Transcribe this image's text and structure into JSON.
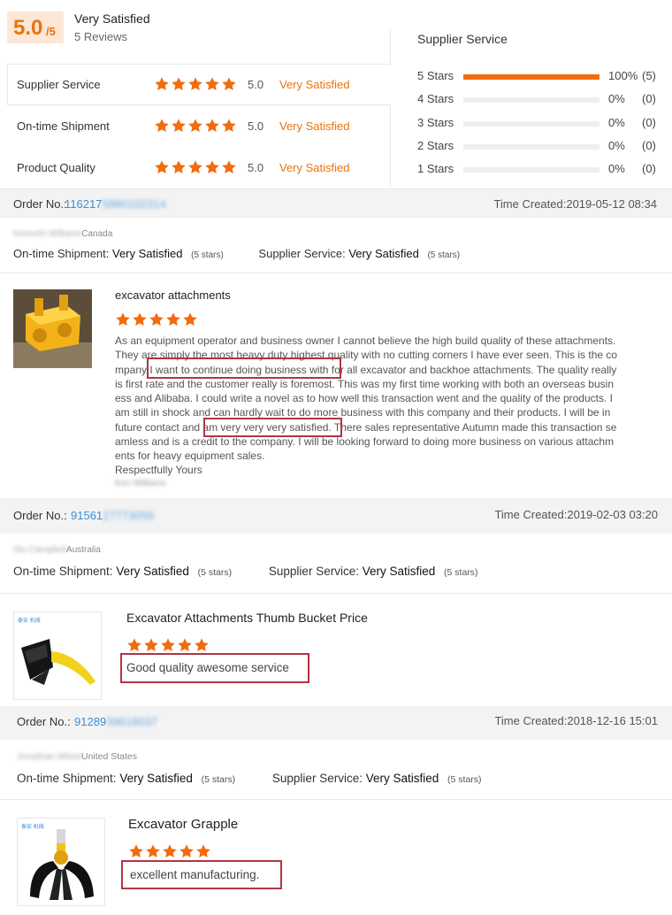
{
  "summary": {
    "score": "5.0",
    "score_suffix": "/5",
    "satisfaction": "Very Satisfied",
    "reviews": "5 Reviews",
    "ratings": [
      {
        "name": "Supplier Service",
        "value": "5.0",
        "text": "Very Satisfied",
        "stars": 5
      },
      {
        "name": "On-time Shipment",
        "value": "5.0",
        "text": "Very Satisfied",
        "stars": 5
      },
      {
        "name": "Product Quality",
        "value": "5.0",
        "text": "Very Satisfied",
        "stars": 5
      }
    ]
  },
  "distribution": {
    "title": "Supplier Service",
    "rows": [
      {
        "label": "5 Stars",
        "fill": 1.0,
        "pct": "100%",
        "count": "(5)"
      },
      {
        "label": "4 Stars",
        "fill": 0,
        "pct": "0%",
        "count": "(0)"
      },
      {
        "label": "3 Stars",
        "fill": 0,
        "pct": "0%",
        "count": "(0)"
      },
      {
        "label": "2 Stars",
        "fill": 0,
        "pct": "0%",
        "count": "(0)"
      },
      {
        "label": "1 Stars",
        "fill": 0,
        "pct": "0%",
        "count": "(0)"
      }
    ]
  },
  "labels": {
    "order_no": "Order No.:",
    "time_created": "Time Created:",
    "ontime": "On-time Shipment:",
    "supplier": "Supplier Service:",
    "very_satisfied": "Very Satisfied",
    "five_stars": "(5 stars)"
  },
  "reviews": [
    {
      "order_prefix": "116217",
      "order_hidden": "5880102314",
      "time": "2019-05-12 08:34",
      "reviewer": "Kenneth Williams",
      "country": "Canada",
      "product": "excavator attachments",
      "stars": 5,
      "body_lines": [
        "As an equipment operator and business owner I cannot believe the high build quality of these attachments.",
        "They are simply the most heavy duty highest quality with no cutting corners I have ever seen. This is the co",
        "mpany I want to continue doing business with for all excavator and backhoe attachments. The quality really",
        "is first rate and the customer really is foremost. This was my first time working with both an overseas busin",
        "ess and Alibaba. I could write a novel as to how well this transaction went and the quality of the products. I",
        "am still in shock and can hardly wait to do more business with this company and their products. I will be in",
        "future contact and am very very very satisfied. There sales representative Autumn made this transaction se",
        "amless and is a credit to the company. I will be looking forward to doing more business on various attachm",
        "ents for heavy equipment sales."
      ],
      "closing": "Respectfully Yours",
      "signature": "Ken Williams"
    },
    {
      "order_prefix": "91561",
      "order_hidden": "27773056",
      "time": "2019-02-03 03:20",
      "reviewer": "Stu Campbell",
      "country": "Australia",
      "product": "Excavator Attachments Thumb Bucket Price",
      "stars": 5,
      "body": "Good quality awesome service",
      "logo_text": "泰安 机械"
    },
    {
      "order_prefix": "91289",
      "order_hidden": "39616037",
      "time": "2018-12-16 15:01",
      "reviewer": "Jonathan Alford",
      "country": "United States",
      "product": "Excavator Grapple",
      "stars": 5,
      "body": "excellent manufacturing.",
      "logo_text": "泰安 机械"
    }
  ],
  "colors": {
    "accent": "#e8730c",
    "star": "#f26c0d",
    "link": "#3b8fd6",
    "highlight_box": "#b03545"
  }
}
